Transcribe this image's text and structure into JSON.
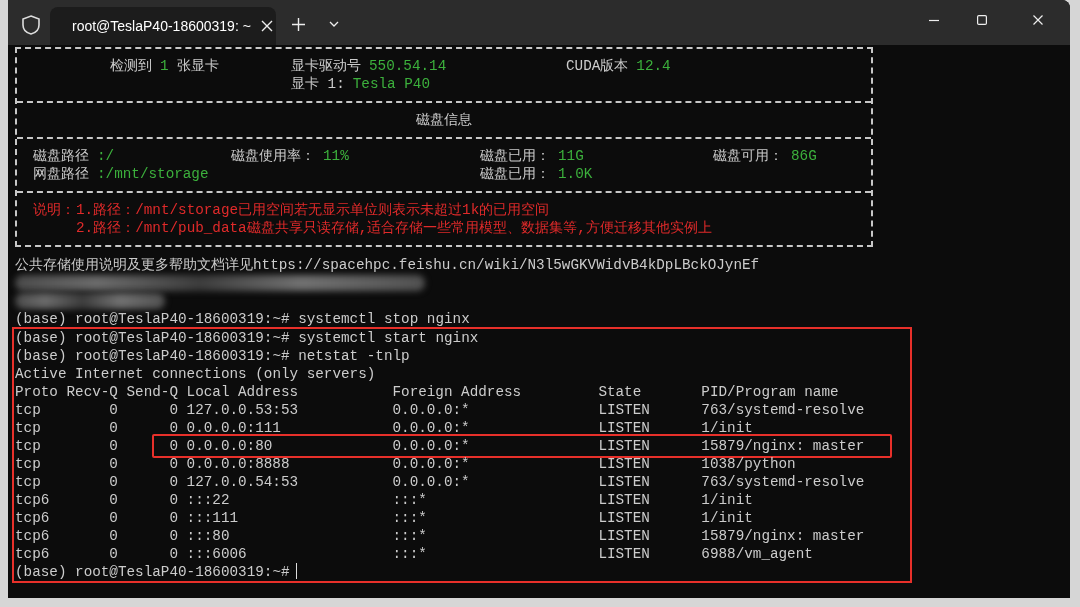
{
  "window": {
    "tabs": [
      {
        "title": "root@TeslaP40-18600319: ~",
        "selected": true
      }
    ]
  },
  "gpu_panel": {
    "summary": [
      {
        "label": "检测到",
        "value": "1",
        "suffix": "张显卡"
      },
      {
        "label": "显卡驱动号",
        "value": "550.54.14"
      },
      {
        "label": "CUDA版本",
        "value": "12.4"
      }
    ],
    "cards": [
      {
        "label": "显卡 1:",
        "value": "Tesla P40"
      }
    ]
  },
  "disk_panel": {
    "title": "磁盘信息",
    "rows": [
      {
        "path": {
          "label": "磁盘路径",
          "value": ":/"
        },
        "usage": {
          "label": "磁盘使用率：",
          "value": "11%"
        },
        "used": {
          "label": "磁盘已用：",
          "value": "11G"
        },
        "free": {
          "label": "磁盘可用：",
          "value": "86G"
        }
      },
      {
        "path": {
          "label": "网盘路径",
          "value": ":/mnt/storage"
        },
        "used": {
          "label": "磁盘已用：",
          "value": "1.0K"
        }
      }
    ]
  },
  "notes": {
    "title": "说明：",
    "items": [
      "1.路径：/mnt/storage已用空间若无显示单位则表示未超过1k的已用空间",
      "2.路径：/mnt/pub_data磁盘共享只读存储,适合存储一些常用模型、数据集等,方便迁移其他实例上"
    ]
  },
  "session": [
    {
      "kind": "output",
      "text": "公共存储使用说明及更多帮助文档详见https://spacehpc.feishu.cn/wiki/N3l5wGKVWidvB4kDpLBckOJynEf"
    },
    {
      "kind": "redacted"
    },
    {
      "kind": "redacted"
    },
    {
      "kind": "prompt",
      "prompt": "(base) root@TeslaP40-18600319:~#",
      "command": "systemctl stop nginx"
    }
  ],
  "outlined_block": {
    "lines": [
      {
        "kind": "prompt",
        "prompt": "(base) root@TeslaP40-18600319:~#",
        "command": "systemctl start nginx"
      },
      {
        "kind": "prompt",
        "prompt": "(base) root@TeslaP40-18600319:~#",
        "command": "netstat -tnlp"
      },
      {
        "kind": "output",
        "text": "Active Internet connections (only servers)"
      }
    ],
    "table": {
      "columns": [
        "Proto",
        "Recv-Q",
        "Send-Q",
        "Local Address",
        "Foreign Address",
        "State",
        "PID/Program name"
      ],
      "rows": [
        {
          "cells": [
            "tcp",
            "0",
            "0",
            "127.0.0.53:53",
            "0.0.0.0:*",
            "LISTEN",
            "763/systemd-resolve"
          ],
          "highlighted": false
        },
        {
          "cells": [
            "tcp",
            "0",
            "0",
            "0.0.0.0:111",
            "0.0.0.0:*",
            "LISTEN",
            "1/init"
          ],
          "highlighted": false
        },
        {
          "cells": [
            "tcp",
            "0",
            "0",
            "0.0.0.0:80",
            "0.0.0.0:*",
            "LISTEN",
            "15879/nginx: master"
          ],
          "highlighted": true
        },
        {
          "cells": [
            "tcp",
            "0",
            "0",
            "0.0.0.0:8888",
            "0.0.0.0:*",
            "LISTEN",
            "1038/python"
          ],
          "highlighted": false
        },
        {
          "cells": [
            "tcp",
            "0",
            "0",
            "127.0.0.54:53",
            "0.0.0.0:*",
            "LISTEN",
            "763/systemd-resolve"
          ],
          "highlighted": false
        },
        {
          "cells": [
            "tcp6",
            "0",
            "0",
            ":::22",
            ":::*",
            "LISTEN",
            "1/init"
          ],
          "highlighted": false
        },
        {
          "cells": [
            "tcp6",
            "0",
            "0",
            ":::111",
            ":::*",
            "LISTEN",
            "1/init"
          ],
          "highlighted": false
        },
        {
          "cells": [
            "tcp6",
            "0",
            "0",
            ":::80",
            ":::*",
            "LISTEN",
            "15879/nginx: master"
          ],
          "highlighted": false
        },
        {
          "cells": [
            "tcp6",
            "0",
            "0",
            ":::6006",
            ":::*",
            "LISTEN",
            "6988/vm_agent"
          ],
          "highlighted": false
        }
      ]
    },
    "final_prompt": {
      "prompt": "(base) root@TeslaP40-18600319:~#",
      "cursor": true
    }
  }
}
